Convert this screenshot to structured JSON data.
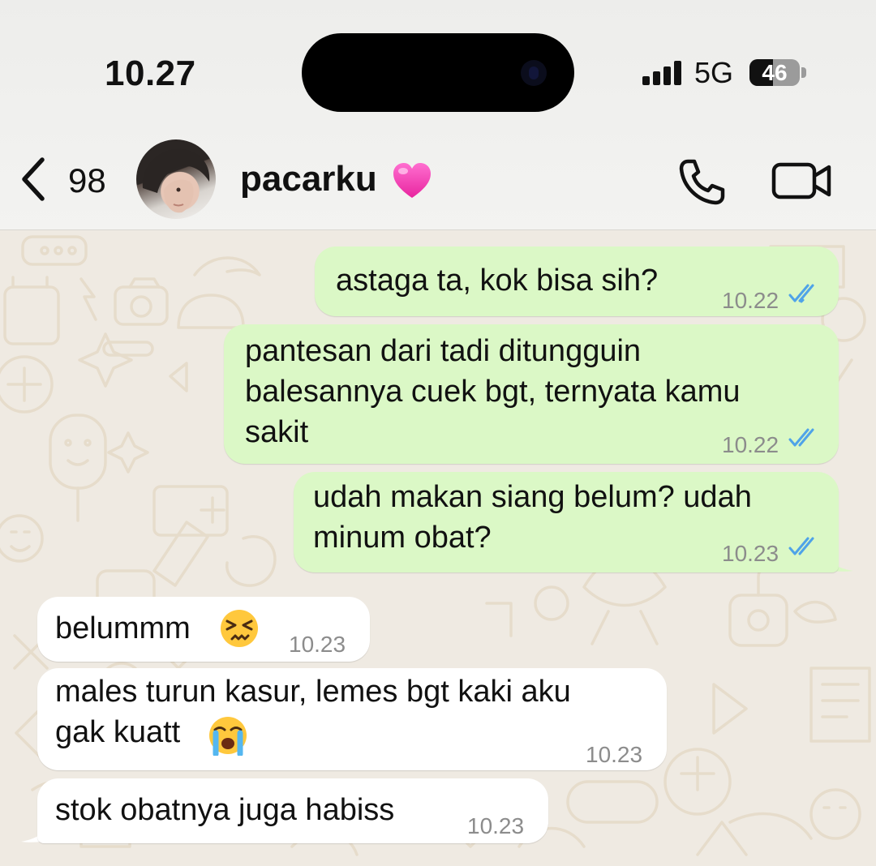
{
  "status_bar": {
    "time": "10.27",
    "network": "5G",
    "battery": "46",
    "battery_level": 0.46
  },
  "header": {
    "back_count": "98",
    "contact_name": "pacarku",
    "icons": [
      "chevron-left-icon",
      "avatar",
      "pink-heart-emoji",
      "phone-icon",
      "video-camera-icon"
    ]
  },
  "messages": [
    {
      "direction": "outgoing",
      "lines": [
        "astaga ta, kok bisa sih?"
      ],
      "time": "10.22",
      "status": "read"
    },
    {
      "direction": "outgoing",
      "lines": [
        "pantesan dari tadi ditungguin",
        "balesannya cuek bgt, ternyata kamu",
        "sakit"
      ],
      "time": "10.22",
      "status": "read"
    },
    {
      "direction": "outgoing",
      "lines": [
        "udah makan siang belum? udah",
        "minum obat?"
      ],
      "time": "10.23",
      "status": "read"
    },
    {
      "direction": "incoming",
      "lines": [
        "belummm"
      ],
      "emoji": "persevering-face",
      "time": "10.23"
    },
    {
      "direction": "incoming",
      "lines": [
        "males turun kasur, lemes bgt kaki aku",
        "gak kuatt"
      ],
      "emoji": "loudly-crying-face",
      "time": "10.23"
    },
    {
      "direction": "incoming",
      "lines": [
        "stok obatnya juga habiss"
      ],
      "time": "10.23"
    }
  ],
  "colors": {
    "outgoing_bubble": "#dbf8c6",
    "incoming_bubble": "#ffffff",
    "read_ticks": "#4fa3e8",
    "chat_background": "#efeae2"
  }
}
